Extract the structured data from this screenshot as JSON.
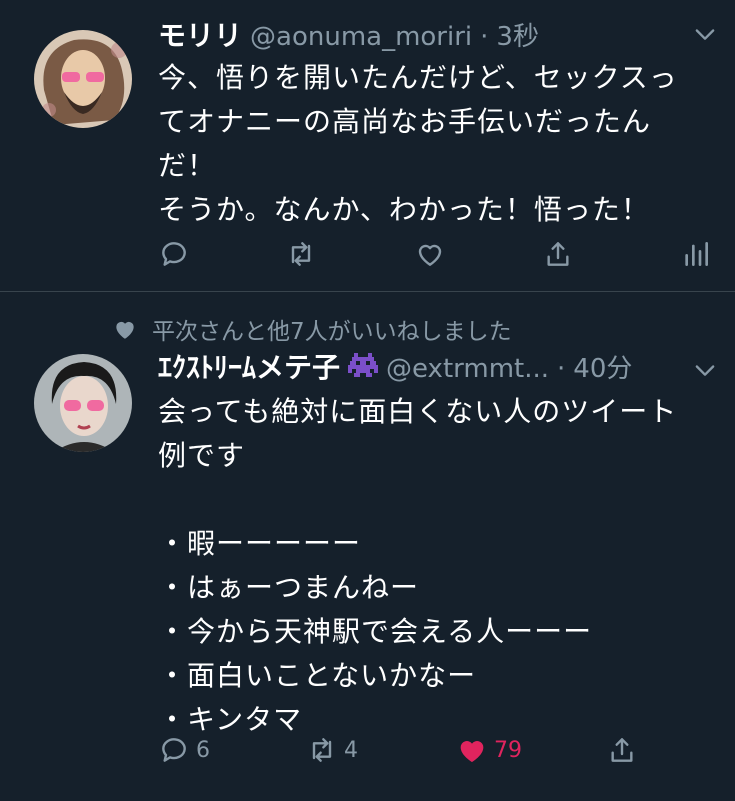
{
  "tweet1": {
    "name": "モリリ",
    "handle": "@aonuma_moriri",
    "dot": "·",
    "time": "3秒",
    "text": "今、悟りを開いたんだけど、セックスっ\nてオナニーの高尚なお手伝いだったん\nだ！\nそうか。なんか、わかった！悟った！",
    "actions": {
      "reply_icon": "reply-icon",
      "retweet_icon": "retweet-icon",
      "like_icon": "heart-icon",
      "share_icon": "share-icon",
      "analytics_icon": "analytics-icon"
    }
  },
  "tweet2": {
    "social_context": "平次さんと他7人がいいねしました",
    "name": "ｴｸｽﾄﾘｰﾑメテ子",
    "name_emoji": "alien-monster-emoji",
    "handle": "@extrmmt...",
    "dot": "·",
    "time": "40分",
    "text": "会っても絶対に面白くない人のツイート\n例です\n\n・暇ーーーーー\n・はぁーつまんねー\n・今から天神駅で会える人ーーー\n・面白いことないかなー\n・キンタマ",
    "reply_count": "6",
    "retweet_count": "4",
    "like_count": "79",
    "liked": true
  },
  "colors": {
    "background": "#15202b",
    "text_primary": "#ffffff",
    "text_secondary": "#8899a6",
    "divider": "#38444d",
    "like_active": "#e0245e"
  }
}
